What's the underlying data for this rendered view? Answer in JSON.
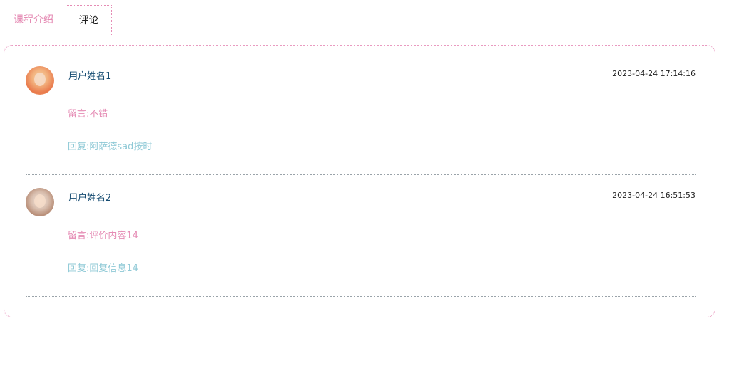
{
  "tabs": [
    {
      "label": "课程介绍",
      "active": false
    },
    {
      "label": "评论",
      "active": true
    }
  ],
  "comments": [
    {
      "username": "用户姓名1",
      "time": "2023-04-24 17:14:16",
      "message": "留言:不错",
      "reply": "回复:阿萨德sad按时"
    },
    {
      "username": "用户姓名2",
      "time": "2023-04-24 16:51:53",
      "message": "留言:评价内容14",
      "reply": "回复:回复信息14"
    }
  ],
  "colors": {
    "accent_pink": "#e58bb4",
    "reply_teal": "#8fc9d6",
    "username_blue": "#164c72"
  }
}
